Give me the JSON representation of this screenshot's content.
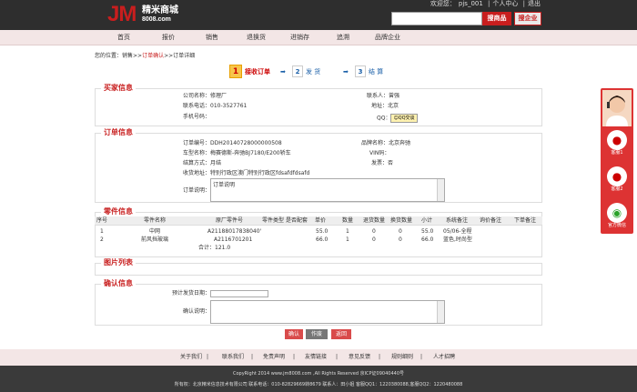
{
  "header": {
    "logo_mark": "JM",
    "logo_cn": "精米商城",
    "logo_url": "8008.com",
    "welcome": "欢迎您：",
    "user": "pjs_001",
    "personal_center": "个人中心",
    "logout": "退出",
    "search_parts_btn": "搜商品",
    "search_company_btn": "搜企业",
    "search_placeholder": ""
  },
  "nav": [
    "首页",
    "报价",
    "销售",
    "退换货",
    "进销存",
    "追溯",
    "品牌企业"
  ],
  "breadcrumb": {
    "prefix": "您的位置：销售>>",
    "current": "订单确认",
    "suffix": ">>订单详细"
  },
  "steps": [
    {
      "num": "1",
      "label": "接收订单"
    },
    {
      "num": "2",
      "label": "发 货"
    },
    {
      "num": "3",
      "label": "结 算"
    }
  ],
  "buyer": {
    "title": "买家信息",
    "company_label": "公司名称：",
    "company": "修理厂",
    "phone_label": "联系电话：",
    "phone": "010-3527761",
    "mobile_label": "手机号码：",
    "mobile": "",
    "contact_label": "联系人：",
    "contact": "曾强",
    "address_label": "地址：",
    "address": "北京",
    "qq_label": "QQ：",
    "qq_btn": "QQ交谈"
  },
  "order": {
    "title": "订单信息",
    "order_no_label": "订单编号：",
    "order_no": "DDH20140728000000508",
    "vehicle_label": "车型名称：",
    "vehicle": "梅赛德斯-奔驰BJ7180/E200轿车",
    "settle_label": "结算方式：",
    "settle": "月结",
    "address_label": "收货地址：",
    "address": "特别行政区澳门特别行政区fdsafdfdsafd",
    "note_label": "订单说明：",
    "note": "订单说明",
    "brand_label": "品牌名称：",
    "brand": "北京奔驰",
    "vin_label": "VIN码：",
    "vin": "",
    "invoice_label": "发票：",
    "invoice": "否"
  },
  "parts": {
    "title": "零件信息",
    "headers": [
      "序号",
      "零件名称",
      "原厂零件号",
      "零件类型",
      "是否配套",
      "单价",
      "数量",
      "退货数量",
      "换货数量",
      "小计",
      "系统备注",
      "询价备注",
      "下单备注"
    ],
    "rows": [
      [
        "1",
        "中网",
        "A21188017838040'",
        "",
        "",
        "55.0",
        "1",
        "0",
        "0",
        "55.0",
        "05/06-全程",
        "",
        ""
      ],
      [
        "2",
        "前风挡玻璃",
        "A2116701201",
        "",
        "",
        "66.0",
        "1",
        "0",
        "0",
        "66.0",
        "蓝色,时尚型",
        "",
        ""
      ]
    ],
    "total_label": "合计：",
    "total": "121.0"
  },
  "images": {
    "title": "图片列表"
  },
  "confirm": {
    "title": "确认信息",
    "ship_date_label": "预计发货日期：",
    "ship_date": "",
    "note_label": "确认说明："
  },
  "buttons": {
    "confirm": "确认",
    "cancel": "作废",
    "back": "返回"
  },
  "footer_links": [
    "关于我们",
    "联系我们",
    "免责声明",
    "友情链接",
    "意见反馈",
    "规则细则",
    "人才招聘"
  ],
  "footer": {
    "copyright": "CopyRight 2014 www.jm8008.com ,All Rights Reserved 京ICP证09040440号",
    "company": "所有权：北京精米信息技术有限公司 联系电话：010-82829669转8679 联系人：田小姐 客服QQ1：1220380088,客服QQ2：1220480088"
  },
  "customer_service": {
    "items": [
      "客服1",
      "客服2",
      "官方微信"
    ]
  },
  "colors": {
    "brand_red": "#c81e1e",
    "header_bg": "#2e2e2e",
    "nav_bg": "#f3e6e6"
  }
}
